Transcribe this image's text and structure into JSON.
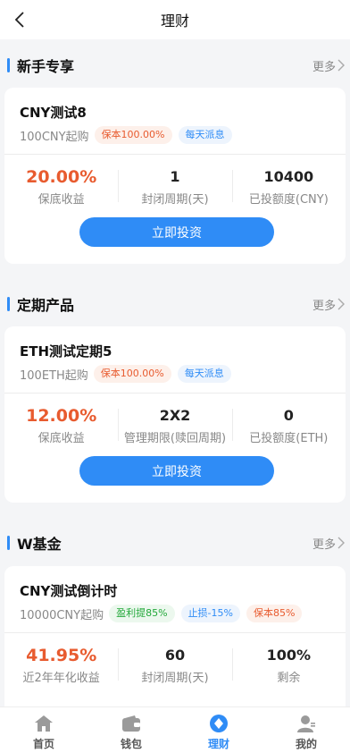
{
  "header": {
    "title": "理财"
  },
  "sections": [
    {
      "name": "新手专享",
      "more": "更多",
      "product": {
        "name": "CNY测试8",
        "min_buy": "100CNY起购",
        "tags": [
          {
            "text": "保本100.00%",
            "style": "red"
          },
          {
            "text": "每天派息",
            "style": "blue"
          }
        ],
        "stats": [
          {
            "value": "20.00%",
            "label": "保底收益"
          },
          {
            "value": "1",
            "label": "封闭周期(天)"
          },
          {
            "value": "10400",
            "label": "已投额度(CNY)"
          }
        ],
        "button": "立即投资"
      }
    },
    {
      "name": "定期产品",
      "more": "更多",
      "product": {
        "name": "ETH测试定期5",
        "min_buy": "100ETH起购",
        "tags": [
          {
            "text": "保本100.00%",
            "style": "red"
          },
          {
            "text": "每天派息",
            "style": "blue"
          }
        ],
        "stats": [
          {
            "value": "12.00%",
            "label": "保底收益"
          },
          {
            "value": "2X2",
            "label": "管理期限(赎回周期)"
          },
          {
            "value": "0",
            "label": "已投额度(ETH)"
          }
        ],
        "button": "立即投资"
      }
    },
    {
      "name": "W基金",
      "more": "更多",
      "product": {
        "name": "CNY测试倒计时",
        "min_buy": "10000CNY起购",
        "tags": [
          {
            "text": "盈利提85%",
            "style": "green"
          },
          {
            "text": "止损-15%",
            "style": "blue"
          },
          {
            "text": "保本85%",
            "style": "red"
          }
        ],
        "stats": [
          {
            "value": "41.95%",
            "label": "近2年年化收益"
          },
          {
            "value": "60",
            "label": "封闭周期(天)"
          },
          {
            "value": "100%",
            "label": "剩余"
          }
        ]
      }
    }
  ],
  "tabbar": [
    {
      "label": "首页",
      "icon": "home-icon"
    },
    {
      "label": "钱包",
      "icon": "wallet-icon"
    },
    {
      "label": "理财",
      "icon": "finance-icon",
      "active": true
    },
    {
      "label": "我的",
      "icon": "user-icon"
    }
  ],
  "colors": {
    "accent": "#2f8cf6",
    "highlight": "#e85b2f",
    "tag_green": "#22a83a"
  }
}
